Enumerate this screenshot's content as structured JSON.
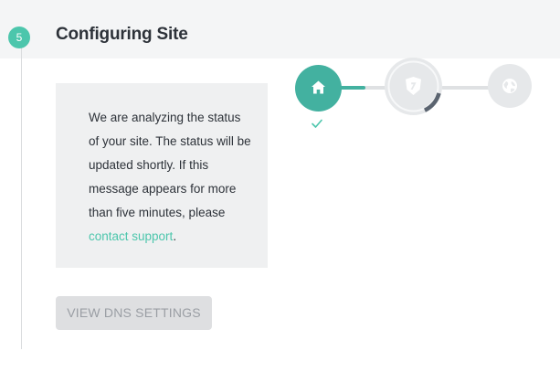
{
  "step": {
    "number": "5",
    "title": "Configuring Site"
  },
  "info": {
    "message": "We are analyzing the status of your site. The status will be updated shortly. If this message appears for more than five minutes, please ",
    "link_text": "contact support",
    "after_link": "."
  },
  "button": {
    "label": "VIEW DNS SETTINGS"
  },
  "progress": {
    "steps": [
      {
        "icon": "home-icon",
        "state": "complete"
      },
      {
        "icon": "shield-icon",
        "state": "in-progress",
        "fraction_complete": 0.25
      },
      {
        "icon": "globe-icon",
        "state": "pending"
      }
    ]
  },
  "colors": {
    "accent": "#4cc6ac",
    "accent_dark": "#43b1a0",
    "header_bg": "#f4f5f6",
    "box_bg": "#eff0f1",
    "pending_gray": "#e6e8ea",
    "button_bg": "#dedfe1",
    "button_text": "#9a9ea4",
    "ring_arc": "#5b6470"
  }
}
